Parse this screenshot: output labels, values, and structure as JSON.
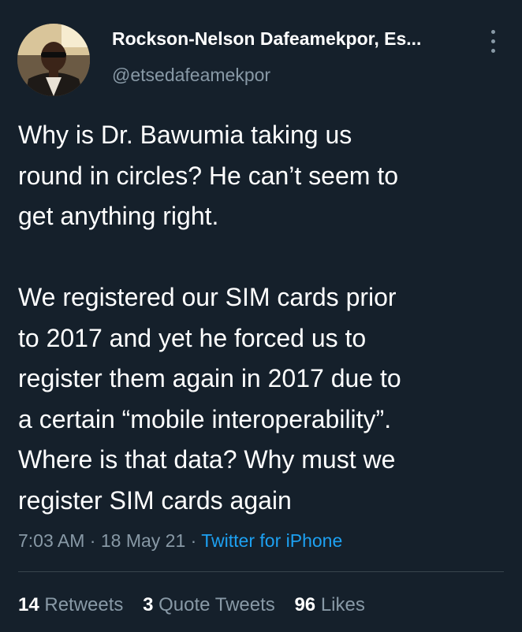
{
  "tweet": {
    "author": {
      "display_name": "Rockson-Nelson Dafeamekpor, Es...",
      "handle": "@etsedafeamekpor"
    },
    "text_lines": [
      "Why is Dr. Bawumia taking us",
      "round in circles? He can’t seem to",
      "get anything right.",
      "We registered our SIM cards prior",
      "to 2017 and yet he forced us to",
      "register them again in 2017 due to",
      "a certain “mobile interoperability”.",
      "Where is that data? Why must we",
      "register SIM cards again"
    ],
    "time": "7:03 AM",
    "date": "18 May 21",
    "separator": " · ",
    "source": "Twitter for iPhone"
  },
  "stats": {
    "retweets_count": "14",
    "retweets_label": "Retweets",
    "quote_tweets_count": "3",
    "quote_tweets_label": "Quote Tweets",
    "likes_count": "96",
    "likes_label": "Likes"
  },
  "colors": {
    "background": "#15202b",
    "primary_text": "#ffffff",
    "secondary_text": "#8899a6",
    "accent": "#1da1f2",
    "divider": "#38444d"
  },
  "icons": {
    "more": "vertical-ellipsis-icon"
  }
}
